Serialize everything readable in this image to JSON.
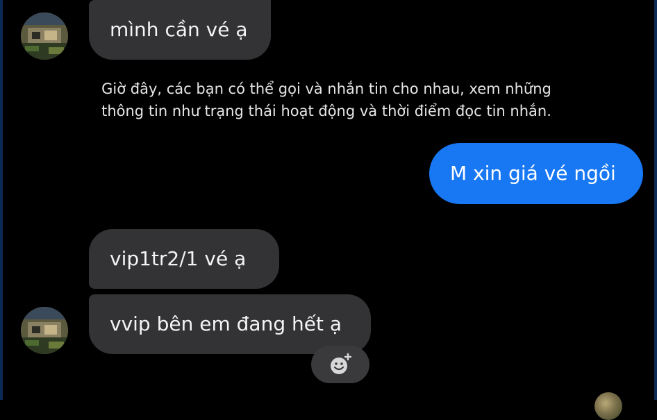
{
  "conversation": {
    "messages": [
      {
        "side": "in",
        "text": "mình cần vé ạ"
      },
      {
        "side": "out",
        "text": "M xin giá vé ngồi"
      },
      {
        "side": "in",
        "text": "vip1tr2/1 vé ạ"
      },
      {
        "side": "in",
        "text": "vvip bên em đang hết ạ"
      }
    ],
    "notice_line1": "Giờ đây, các bạn có thể gọi và nhắn tin cho nhau, xem những",
    "notice_line2": "thông tin như trạng thái hoạt động và thời điểm đọc tin nhắn."
  },
  "icons": {
    "avatar": "contact-avatar",
    "reaction": "add-reaction-icon"
  },
  "colors": {
    "background": "#000000",
    "incoming_bubble": "#333336",
    "outgoing_bubble": "#1877f2",
    "text": "#f4f4f4"
  }
}
